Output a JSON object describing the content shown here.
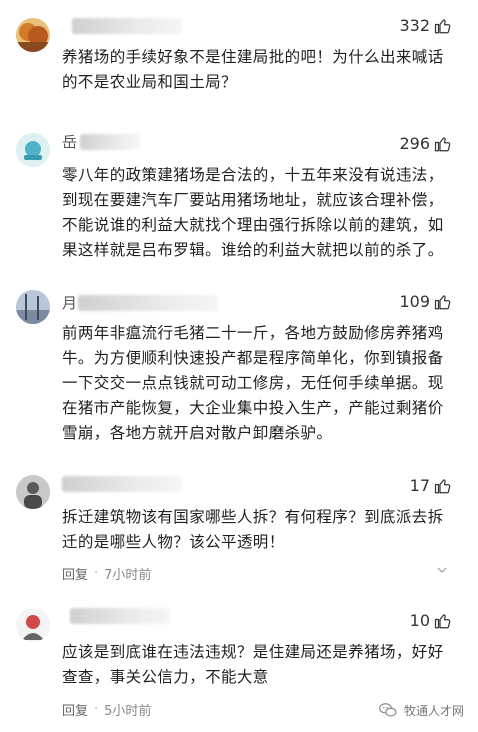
{
  "comments": [
    {
      "name_initial": "",
      "likes": "332",
      "text": "养猪场的手续好象不是住建局批的吧！为什么出来喊话的不是农业局和国土局？",
      "reply_label": "",
      "time": ""
    },
    {
      "name_initial": "岳",
      "likes": "296",
      "text": "零八年的政策建猪场是合法的，十五年来没有说违法，到现在要建汽车厂要站用猪场地址，就应该合理补偿，不能说谁的利益大就找个理由强行拆除以前的建筑，如果这样就是吕布罗辑。谁给的利益大就把以前的杀了。",
      "reply_label": "",
      "time": ""
    },
    {
      "name_initial": "月",
      "likes": "109",
      "text": "前两年非瘟流行毛猪二十一斤，各地方鼓励修房养猪鸡牛。为方便顺利快速投产都是程序简单化，你到镇报备一下交交一点点钱就可动工修房，无任何手续单据。现在猪市产能恢复，大企业集中投入生产，产能过剩猪价雪崩，各地方就开启对散户卸磨杀驴。",
      "reply_label": "",
      "time": ""
    },
    {
      "name_initial": "",
      "likes": "17",
      "text": "拆迁建筑物该有国家哪些人拆？有何程序？到底派去拆迁的是哪些人物？该公平透明！",
      "reply_label": "回复",
      "time": "7小时前"
    },
    {
      "name_initial": "",
      "likes": "10",
      "text": "应该是到底谁在违法违规？是住建局还是养猪场，好好查查，事关公信力，不能大意",
      "reply_label": "回复",
      "time": "5小时前"
    }
  ],
  "separator": "·",
  "more_icon": "chevron-down-icon",
  "watermark": {
    "text": "牧通人才网",
    "icon": "wechat-logo-icon"
  },
  "colors": {
    "text": "#1f1f1f",
    "meta": "#888888",
    "likes": "#333333"
  }
}
